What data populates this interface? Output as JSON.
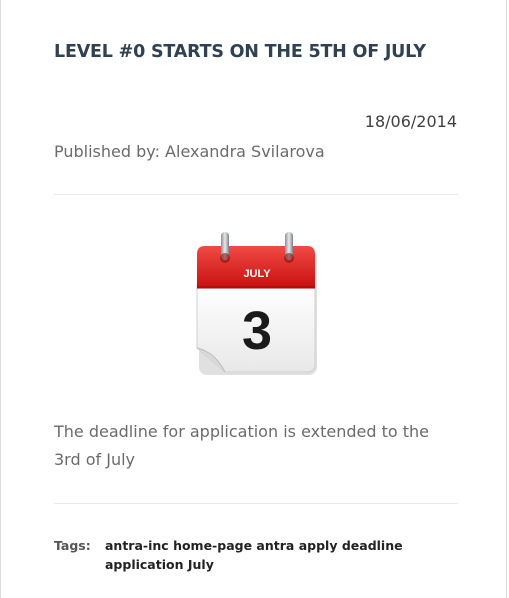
{
  "post": {
    "title": "LEVEL #0 STARTS ON THE 5TH OF JULY",
    "date": "18/06/2014",
    "author_label": "Published by: Alexandra Svilarova",
    "content": "The deadline for application is extended to the 3rd of July",
    "image": {
      "icon": "calendar-icon",
      "month": "JULY",
      "day": "3",
      "accent_color": "#d7191c"
    },
    "tags_label": "Tags:",
    "tags": [
      "antra-inc",
      "home-page",
      "antra",
      "apply",
      "deadline",
      "application",
      "July"
    ]
  }
}
